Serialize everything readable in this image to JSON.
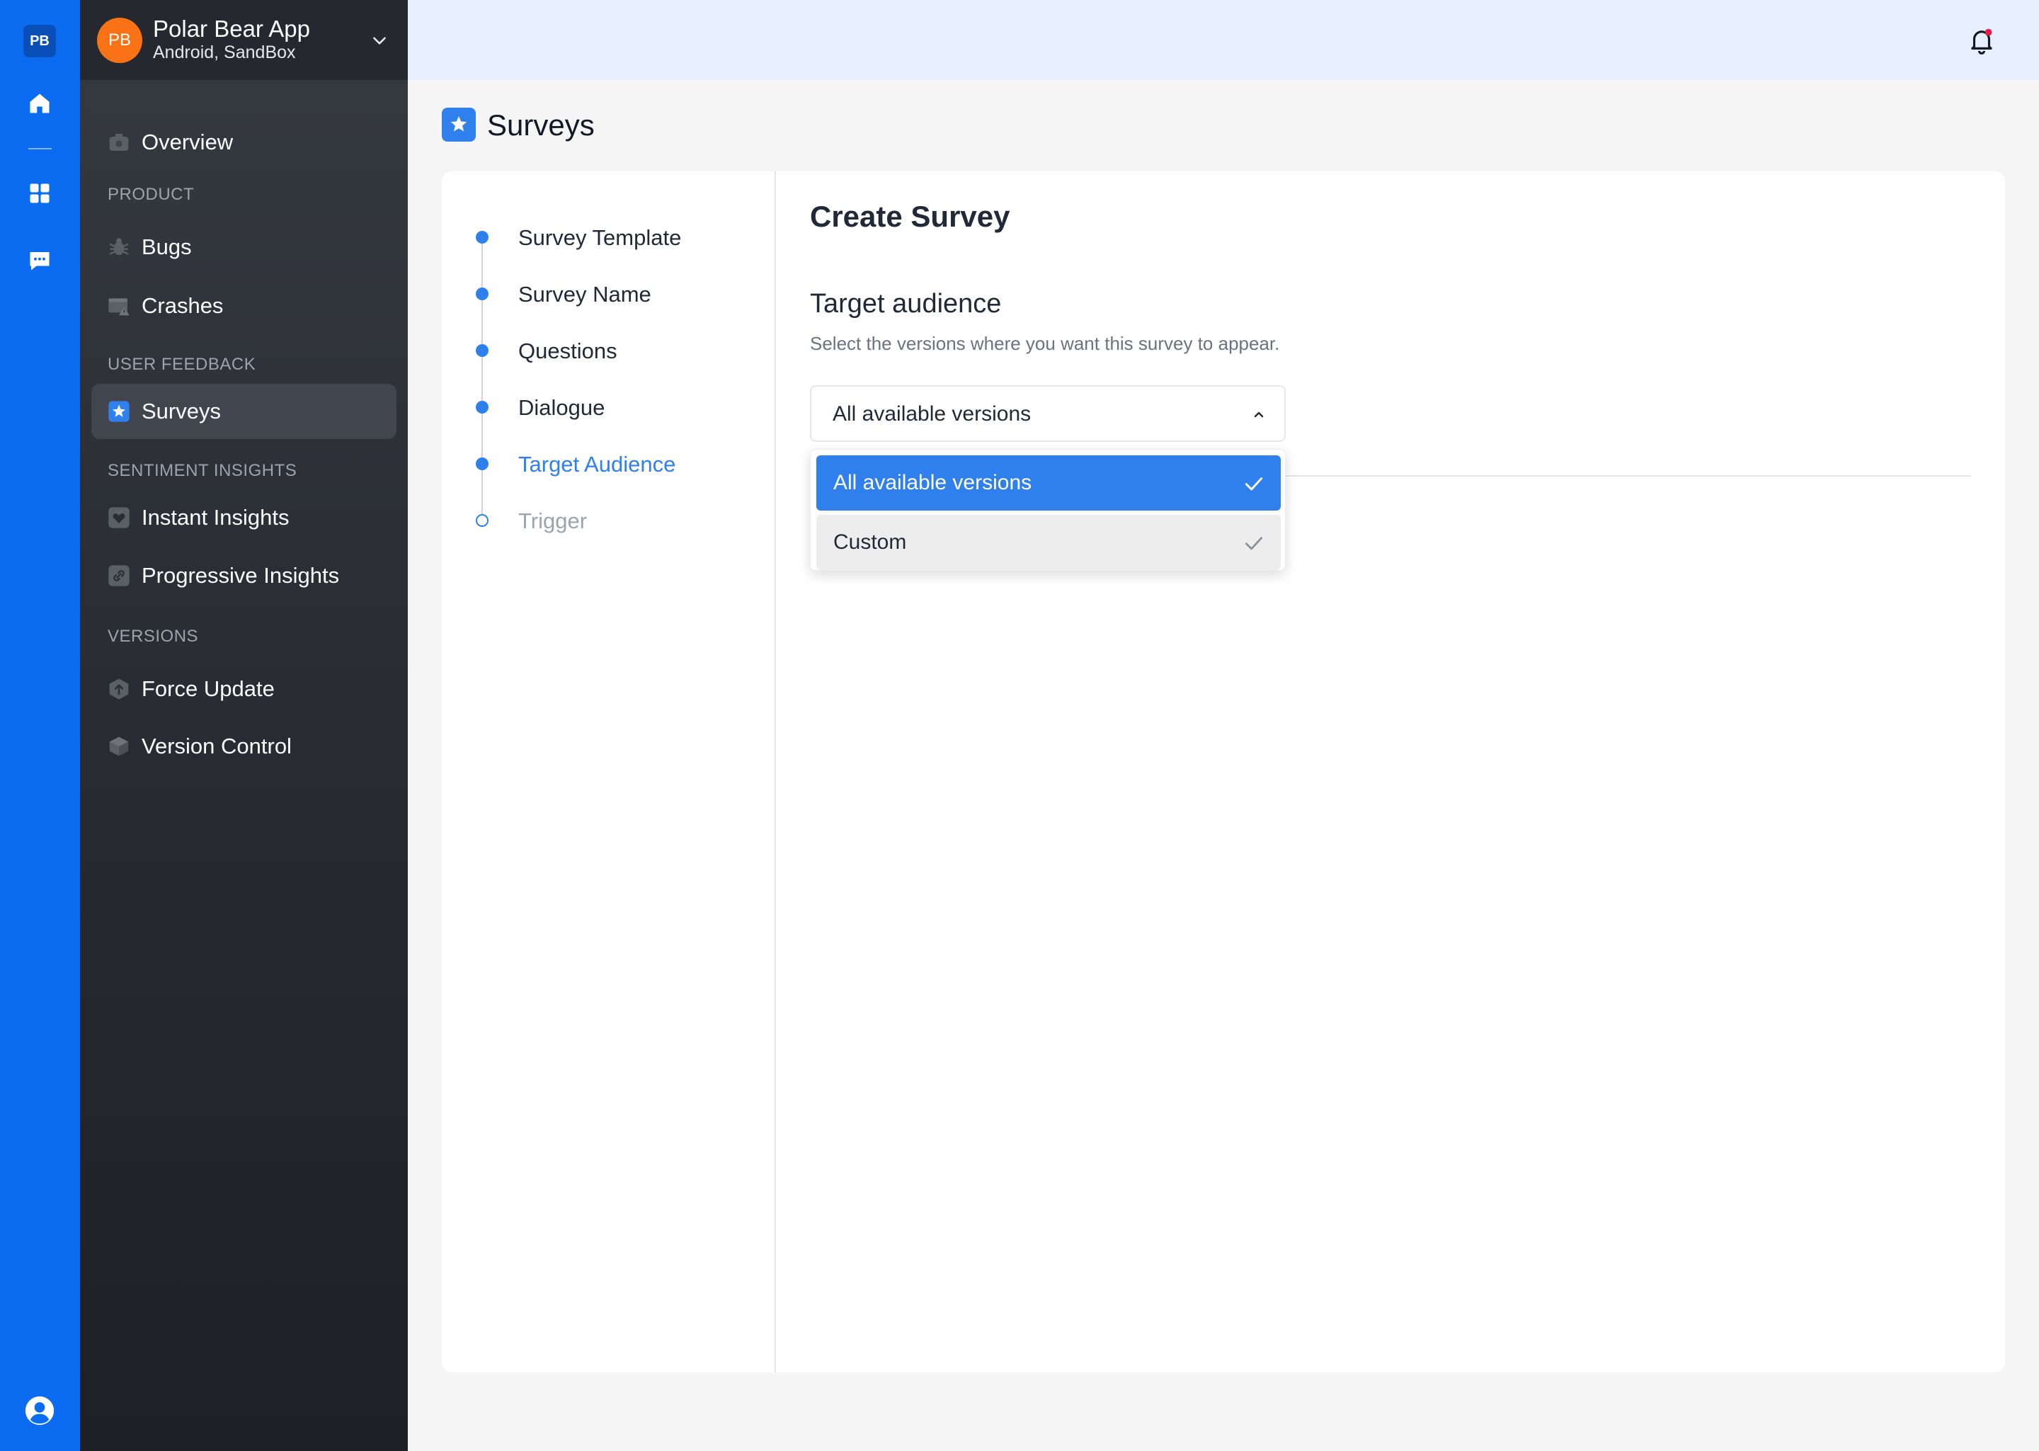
{
  "rail": {
    "logo": "PB",
    "icons": [
      "home-icon",
      "grid-icon",
      "chat-icon",
      "user-circle-icon"
    ],
    "color": "#0b6cf2"
  },
  "app": {
    "avatar": "PB",
    "name": "Polar Bear App",
    "subtitle": "Android, SandBox",
    "avatar_color": "#f97316"
  },
  "sidebar": {
    "overview": "Overview",
    "sections": {
      "product": "PRODUCT",
      "user_feedback": "USER FEEDBACK",
      "sentiment": "SENTIMENT INSIGHTS",
      "versions": "VERSIONS"
    },
    "items": {
      "bugs": "Bugs",
      "crashes": "Crashes",
      "surveys": "Surveys",
      "instant_insights": "Instant Insights",
      "progressive_insights": "Progressive Insights",
      "force_update": "Force Update",
      "version_control": "Version Control"
    },
    "active": "Surveys"
  },
  "page": {
    "title": "Surveys"
  },
  "steps": [
    {
      "label": "Survey Template",
      "state": "done"
    },
    {
      "label": "Survey Name",
      "state": "done"
    },
    {
      "label": "Questions",
      "state": "done"
    },
    {
      "label": "Dialogue",
      "state": "done"
    },
    {
      "label": "Target Audience",
      "state": "current"
    },
    {
      "label": "Trigger",
      "state": "pending"
    }
  ],
  "form": {
    "title": "Create Survey",
    "section_title": "Target audience",
    "section_desc": "Select the versions where you want this survey to appear.",
    "select_value": "All available versions",
    "options": [
      {
        "label": "All available versions",
        "selected": true
      },
      {
        "label": "Custom",
        "selected": false
      }
    ]
  },
  "colors": {
    "accent": "#2f80ed",
    "notification_dot": "#e11d48"
  }
}
